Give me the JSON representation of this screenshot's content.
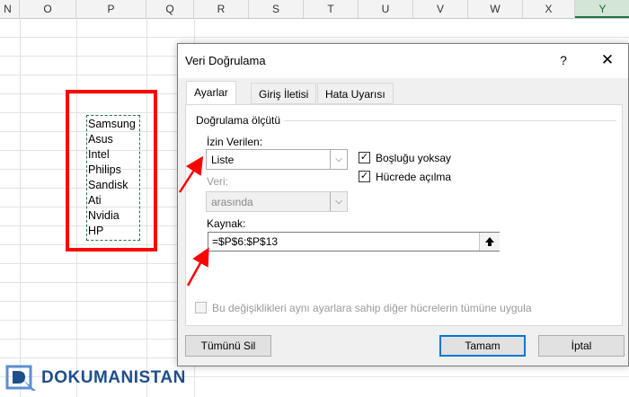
{
  "spreadsheet": {
    "columns": [
      {
        "label": "N"
      },
      {
        "label": "O"
      },
      {
        "label": "P"
      },
      {
        "label": "Q"
      },
      {
        "label": "R"
      },
      {
        "label": "S"
      },
      {
        "label": "T"
      },
      {
        "label": "U"
      },
      {
        "label": "V"
      },
      {
        "label": "W"
      },
      {
        "label": "X"
      },
      {
        "label": "Y"
      }
    ],
    "selected_column": "Y",
    "list_values": [
      "Samsung",
      "Asus",
      "Intel",
      "Philips",
      "Sandisk",
      "Ati",
      "Nvidia",
      "HP"
    ],
    "highlight_color": "#ff0000"
  },
  "dialog": {
    "title": "Veri Doğrulama",
    "help_label": "?",
    "close_label": "✕",
    "tabs": [
      {
        "label": "Ayarlar"
      },
      {
        "label": "Giriş İletisi"
      },
      {
        "label": "Hata Uyarısı"
      }
    ],
    "section_title": "Doğrulama ölçütü",
    "allow": {
      "label": "İzin Verilen:",
      "value": "Liste"
    },
    "data": {
      "label": "Veri:",
      "value": "arasında"
    },
    "ignore_blank": {
      "label": "Boşluğu yoksay",
      "checked": true
    },
    "in_cell_dropdown": {
      "label": "Hücrede açılma",
      "checked": true
    },
    "source": {
      "label": "Kaynak:",
      "value": "=$P$6:$P$13"
    },
    "apply_all": {
      "label": "Bu değişiklikleri aynı ayarlara sahip diğer hücrelerin tümüne uygula",
      "checked": false
    },
    "buttons": {
      "clear_all": "Tümünü Sil",
      "ok": "Tamam",
      "cancel": "İptal"
    },
    "accent_color": "#0078d7"
  },
  "watermark": {
    "text": "DOKUMANISTAN"
  }
}
